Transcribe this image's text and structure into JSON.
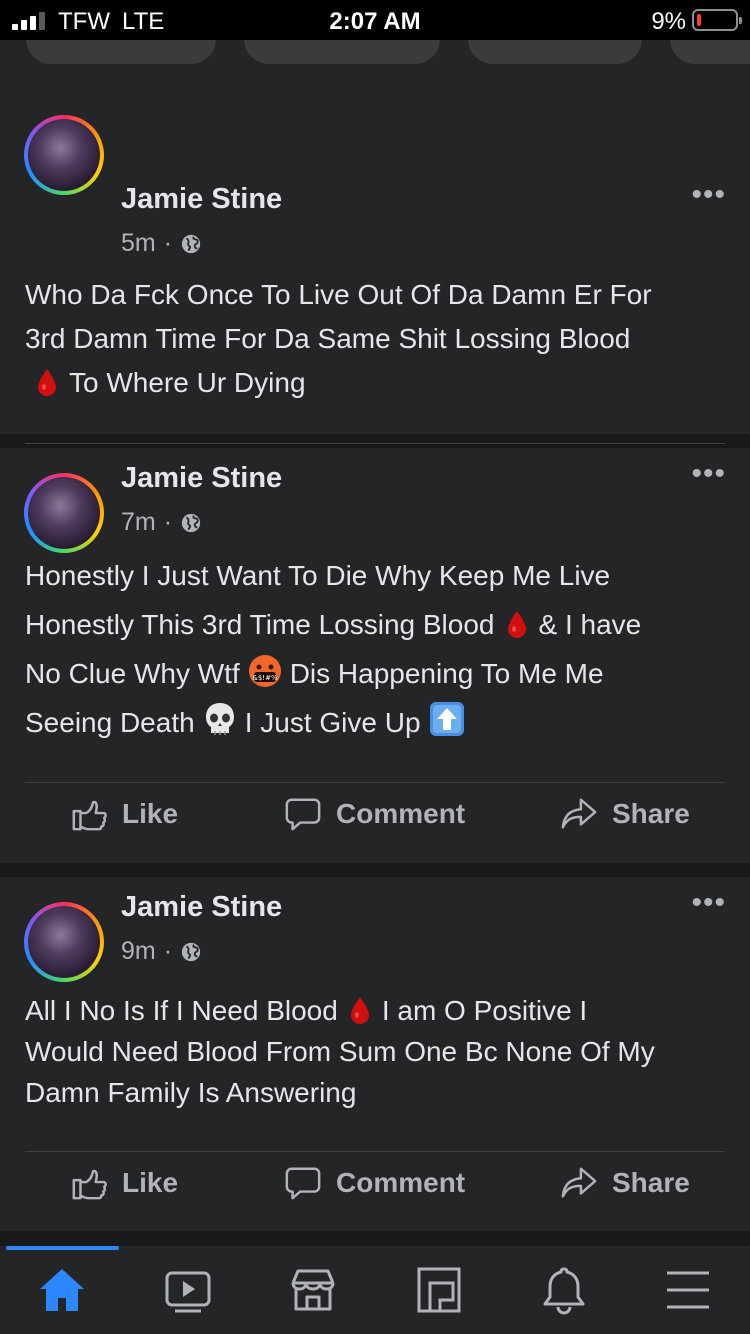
{
  "status_bar": {
    "carrier": "TFW",
    "network": "LTE",
    "time": "2:07 AM",
    "battery_percent": "9%",
    "battery_level": 0.09,
    "signal_bars": 3
  },
  "colors": {
    "background": "#18191a",
    "card": "#242526",
    "primary_text": "#e4e6eb",
    "secondary_text": "#b0b3b8",
    "accent": "#2d88ff",
    "blood_drop": "#d10f0f"
  },
  "posts": [
    {
      "author": "Jamie Stine",
      "time": "5m",
      "privacy_icon": "globe-icon",
      "lines": [
        [
          "Who Da Fck Once To Live Out Of Da Damn Er For"
        ],
        [
          "3rd Damn Time For Da Same Shit Lossing Blood"
        ],
        [
          "drop-of-blood-emoji",
          "To Where Ur Dying"
        ]
      ]
    },
    {
      "author": "Jamie Stine",
      "time": "7m",
      "privacy_icon": "globe-icon",
      "lines": [
        [
          "Honestly I Just Want To Die Why Keep Me Live"
        ],
        [
          "Honestly This 3rd Time Lossing Blood",
          "drop-of-blood-emoji",
          "& I have"
        ],
        [
          "No Clue Why Wtf",
          "cursing-face-emoji",
          "Dis Happening To Me Me"
        ],
        [
          "Seeing Death",
          "skull-emoji",
          "I Just Give Up",
          "up-arrow-emoji"
        ]
      ]
    },
    {
      "author": "Jamie Stine",
      "time": "9m",
      "privacy_icon": "globe-icon",
      "lines": [
        [
          "All I No Is If I Need Blood",
          "drop-of-blood-emoji",
          "I am O Positive I"
        ],
        [
          "Would Need Blood From Sum One Bc None Of My"
        ],
        [
          "Damn Family Is Answering"
        ]
      ]
    }
  ],
  "actions": {
    "like": "Like",
    "comment": "Comment",
    "share": "Share",
    "icons": [
      "thumbs-up-icon",
      "comment-bubble-icon",
      "share-arrow-icon"
    ]
  },
  "more_icon": "more-options-icon",
  "bottom_nav": {
    "active_index": 0,
    "items": [
      "home-icon",
      "watch-video-icon",
      "marketplace-icon",
      "pages-icon",
      "notifications-bell-icon",
      "menu-icon"
    ]
  }
}
